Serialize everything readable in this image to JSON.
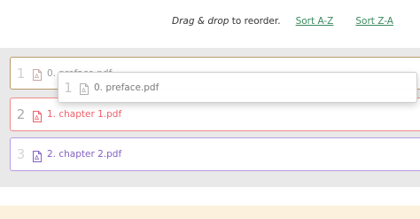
{
  "toolbar": {
    "hint_emphasis": "Drag & drop",
    "hint_rest": " to reorder.",
    "sort_az_label": "Sort A-Z",
    "sort_za_label": "Sort Z-A"
  },
  "files": [
    {
      "order": "1",
      "name": "0. preface.pdf",
      "icon": "pdf-file-icon",
      "state": "placeholder"
    },
    {
      "order": "2",
      "name": "1. chapter 1.pdf",
      "icon": "pdf-file-icon"
    },
    {
      "order": "3",
      "name": "2. chapter 2.pdf",
      "icon": "pdf-file-icon"
    }
  ],
  "drag_ghost": {
    "order": "1",
    "name": "0. preface.pdf",
    "icon": "pdf-file-icon"
  },
  "colors": {
    "link": "#3a8a5f",
    "row1_border": "#b89a6c",
    "row2_border": "#ef8b8b",
    "row2_text": "#ee5f69",
    "row3_border": "#b79be6",
    "row3_text": "#8361c2",
    "panel_bg": "#e9e9e9",
    "footer_bg": "#fbf1dc"
  }
}
